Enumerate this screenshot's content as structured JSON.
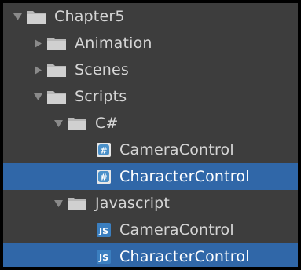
{
  "tree": {
    "chapter": {
      "label": "Chapter5",
      "expanded": true
    },
    "animation": {
      "label": "Animation",
      "expanded": false
    },
    "scenes": {
      "label": "Scenes",
      "expanded": false
    },
    "scripts": {
      "label": "Scripts",
      "expanded": true
    },
    "csharp": {
      "label": "C#",
      "expanded": true,
      "files": [
        {
          "label": "CameraControl",
          "icon": "csharp-script-icon",
          "selected": false
        },
        {
          "label": "CharacterControl",
          "icon": "csharp-script-icon",
          "selected": true
        }
      ]
    },
    "javascript": {
      "label": "Javascript",
      "expanded": true,
      "files": [
        {
          "label": "CameraControl",
          "icon": "javascript-script-icon",
          "selected": false
        },
        {
          "label": "CharacterControl",
          "icon": "javascript-script-icon",
          "selected": true
        }
      ]
    }
  },
  "colors": {
    "background": "#3d3d3d",
    "selection": "#3067a8",
    "text": "#d6d6d6",
    "folder": "#c8c8c8",
    "csharp_icon": "#4a90c9",
    "js_icon": "#3b7fc0"
  }
}
